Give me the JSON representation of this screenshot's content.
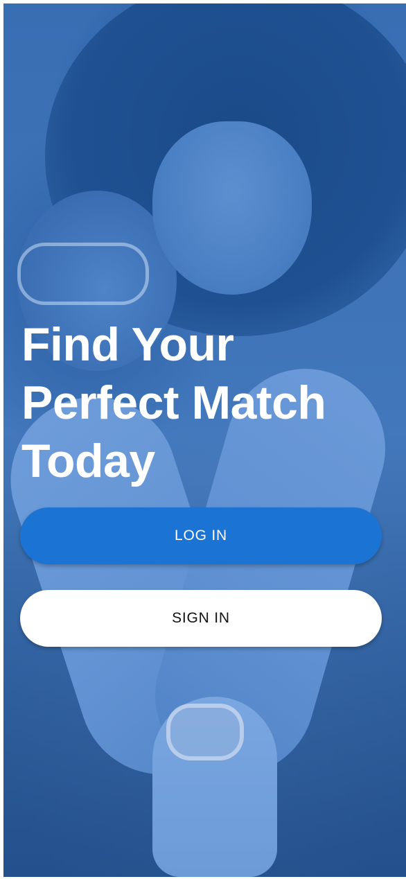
{
  "hero": {
    "headline_line1": "Find Your",
    "headline_line2": "Perfect Match",
    "headline_line3": "Today"
  },
  "actions": {
    "login_label": "LOG IN",
    "signin_label": "SIGN IN"
  },
  "colors": {
    "overlay_blue": "#3f74b8",
    "login_button": "#1b73d3",
    "signin_button": "#ffffff",
    "headline_text": "#ffffff"
  }
}
